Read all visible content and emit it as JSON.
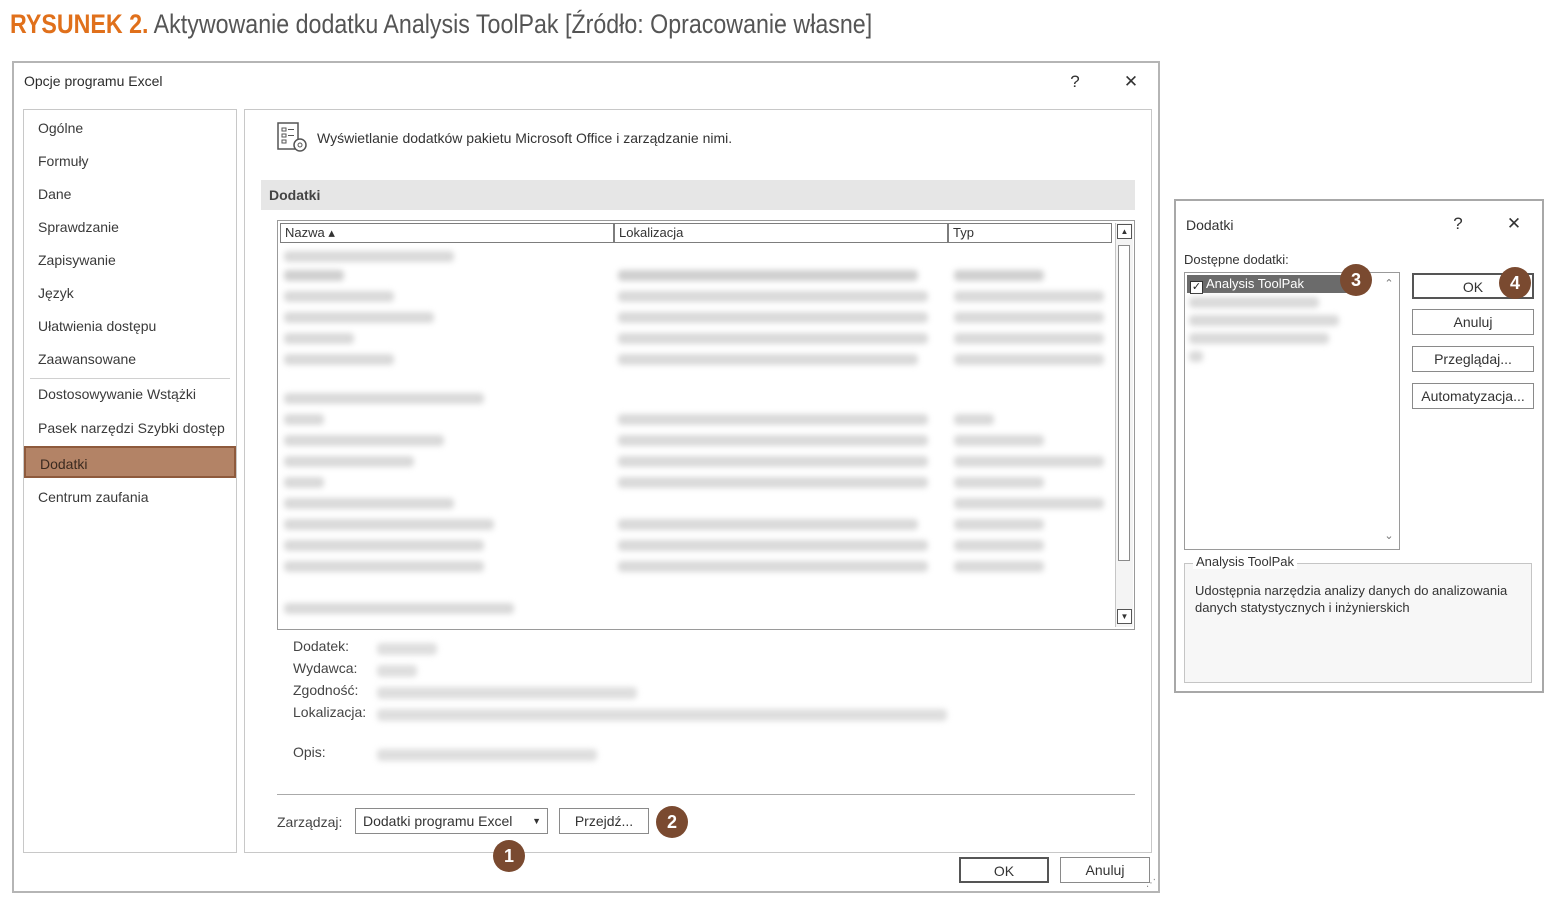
{
  "caption": {
    "figure": "RYSUNEK 2.",
    "text": "Aktywowanie dodatku Analysis ToolPak [Źródło: Opracowanie własne]"
  },
  "dialog": {
    "title": "Opcje programu Excel",
    "help_glyph": "?",
    "close_glyph": "✕",
    "sidebar": {
      "items": [
        {
          "label": "Ogólne"
        },
        {
          "label": "Formuły"
        },
        {
          "label": "Dane"
        },
        {
          "label": "Sprawdzanie"
        },
        {
          "label": "Zapisywanie"
        },
        {
          "label": "Język"
        },
        {
          "label": "Ułatwienia dostępu"
        },
        {
          "label": "Zaawansowane"
        },
        {
          "label": "Dostosowywanie Wstążki"
        },
        {
          "label": "Pasek narzędzi Szybki dostęp"
        },
        {
          "label": "Dodatki"
        },
        {
          "label": "Centrum zaufania"
        }
      ],
      "selected": "Dodatki"
    },
    "header": "Wyświetlanie dodatków pakietu Microsoft Office i zarządzanie nimi.",
    "section_title": "Dodatki",
    "columns": [
      "Nazwa ▴",
      "Lokalizacja",
      "Typ"
    ],
    "info_labels": [
      "Dodatek:",
      "Wydawca:",
      "Zgodność:",
      "Lokalizacja:",
      "Opis:"
    ],
    "manage_label": "Zarządzaj:",
    "manage_value": "Dodatki programu Excel",
    "go_button": "Przejdź...",
    "ok_button": "OK",
    "cancel_button": "Anuluj"
  },
  "addins_dialog": {
    "title": "Dodatki",
    "help_glyph": "?",
    "close_glyph": "✕",
    "available_label": "Dostępne dodatki:",
    "selected_item": "Analysis ToolPak",
    "buttons": {
      "ok": "OK",
      "cancel": "Anuluj",
      "browse": "Przeglądaj...",
      "automation": "Automatyzacja..."
    },
    "group_title": "Analysis ToolPak",
    "group_desc": "Udostępnia narzędzia analizy danych do analizowania danych statystycznych i inżynierskich"
  },
  "badges": [
    "1",
    "2",
    "3",
    "4"
  ],
  "colors": {
    "caption_accent": "#e0701b",
    "selected_item": "#b38366",
    "badge": "#7a4a30"
  },
  "icons": [
    "addins-icon",
    "help-icon",
    "close-icon",
    "dropdown-caret-icon",
    "scroll-up-icon",
    "scroll-down-icon",
    "checkbox-icon"
  ]
}
